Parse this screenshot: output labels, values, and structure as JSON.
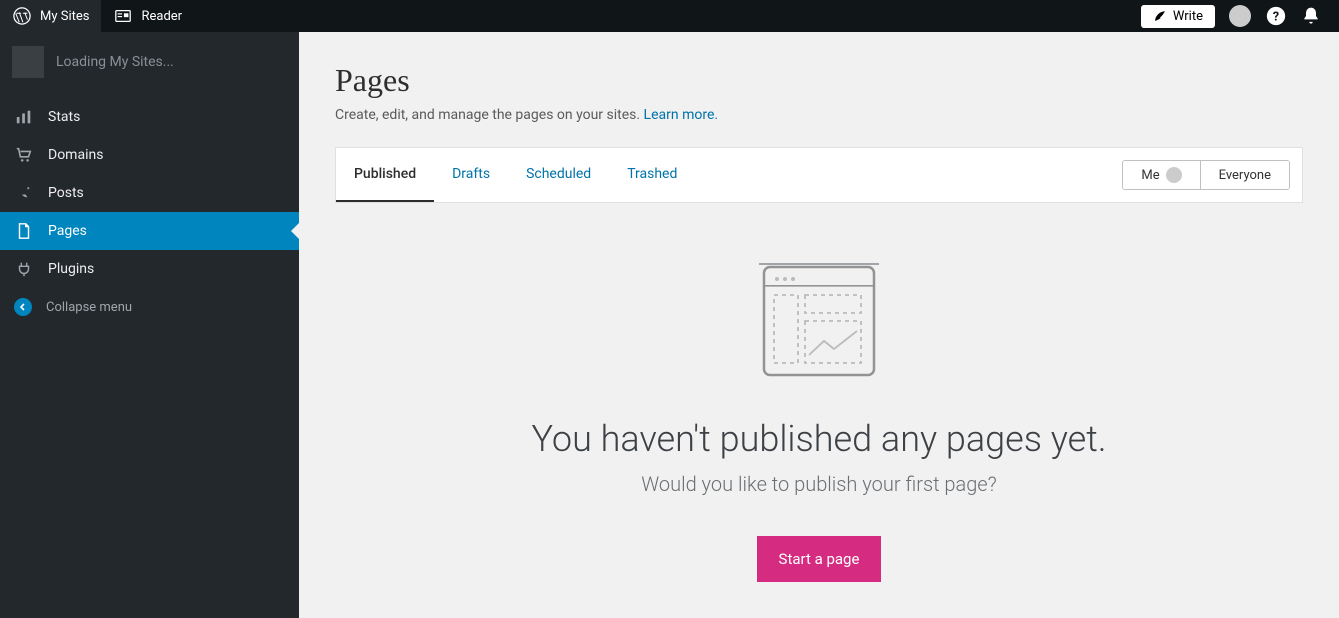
{
  "topbar": {
    "my_sites": "My Sites",
    "reader": "Reader",
    "write": "Write"
  },
  "sidebar": {
    "loading_text": "Loading My Sites...",
    "items": {
      "stats": "Stats",
      "domains": "Domains",
      "posts": "Posts",
      "pages": "Pages",
      "plugins": "Plugins"
    },
    "collapse": "Collapse menu"
  },
  "page": {
    "title": "Pages",
    "description": "Create, edit, and manage the pages on your sites. ",
    "learn_more": "Learn more."
  },
  "tabs": {
    "published": "Published",
    "drafts": "Drafts",
    "scheduled": "Scheduled",
    "trashed": "Trashed"
  },
  "filter": {
    "me": "Me",
    "everyone": "Everyone"
  },
  "empty": {
    "title": "You haven't published any pages yet.",
    "subtitle": "Would you like to publish your first page?",
    "cta": "Start a page"
  }
}
